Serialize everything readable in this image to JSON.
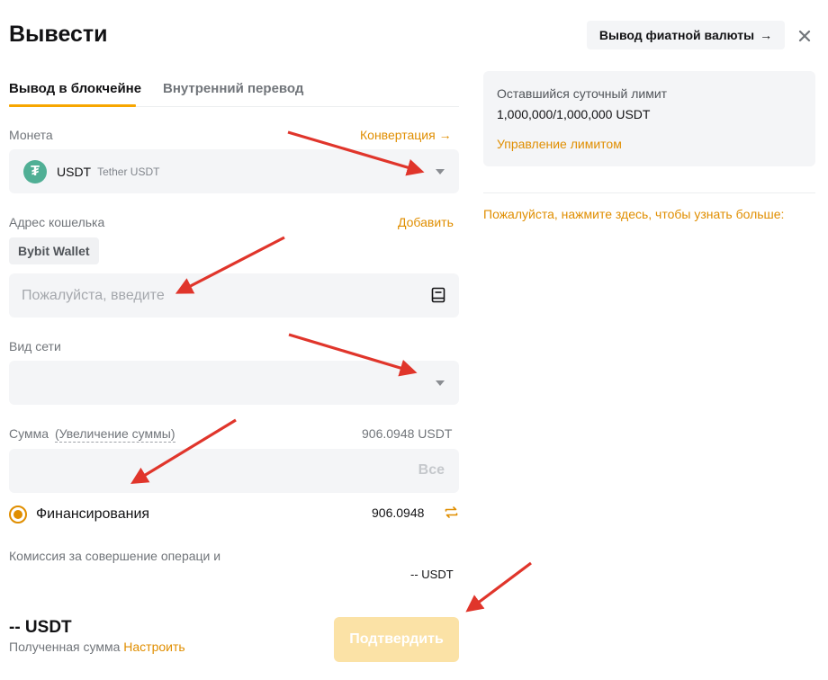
{
  "header": {
    "title": "Вывести",
    "fiat_button": "Вывод фиатной валюты",
    "fiat_arrow": "→",
    "close": "✕"
  },
  "tabs": [
    {
      "label": "Вывод в блокчейне",
      "active": true
    },
    {
      "label": "Внутренний перевод",
      "active": false
    }
  ],
  "coin": {
    "label": "Монета",
    "convert_link": "Конвертация →",
    "symbol": "USDT",
    "name": "Tether USDT",
    "logo_letter": "₮"
  },
  "wallet": {
    "label": "Адрес кошелька",
    "add_link": "Добавить",
    "chip": "Bybit Wallet",
    "placeholder": "Пожалуйста, введите",
    "value": ""
  },
  "network": {
    "label": "Вид сети",
    "selected": ""
  },
  "amount": {
    "label": "Сумма",
    "increase_link": "(Увеличение суммы)",
    "available": "906.0948 USDT",
    "all_button": "Все",
    "value": ""
  },
  "funding": {
    "label": "Финансирования",
    "value": "906.0948"
  },
  "fee": {
    "label": "Комиссия за совершение операци и",
    "value": "-- USDT"
  },
  "received": {
    "amount": "-- USDT",
    "label": "Полученная сумма",
    "settings_link": "Настроить"
  },
  "confirm_button": "Подтвердить",
  "limit": {
    "title": "Оставшийся суточный лимит",
    "value": "1,000,000/1,000,000 USDT",
    "manage_link": "Управление лимитом"
  },
  "learn_more": "Пожалуйста, нажмите здесь, чтобы узнать больше:",
  "colors": {
    "accent": "#f7a600",
    "link": "#e08e00",
    "confirm_disabled": "#fbe2a6",
    "field_bg": "#f4f5f7",
    "tether": "#50af95",
    "annotation_arrow": "#e0352b"
  }
}
